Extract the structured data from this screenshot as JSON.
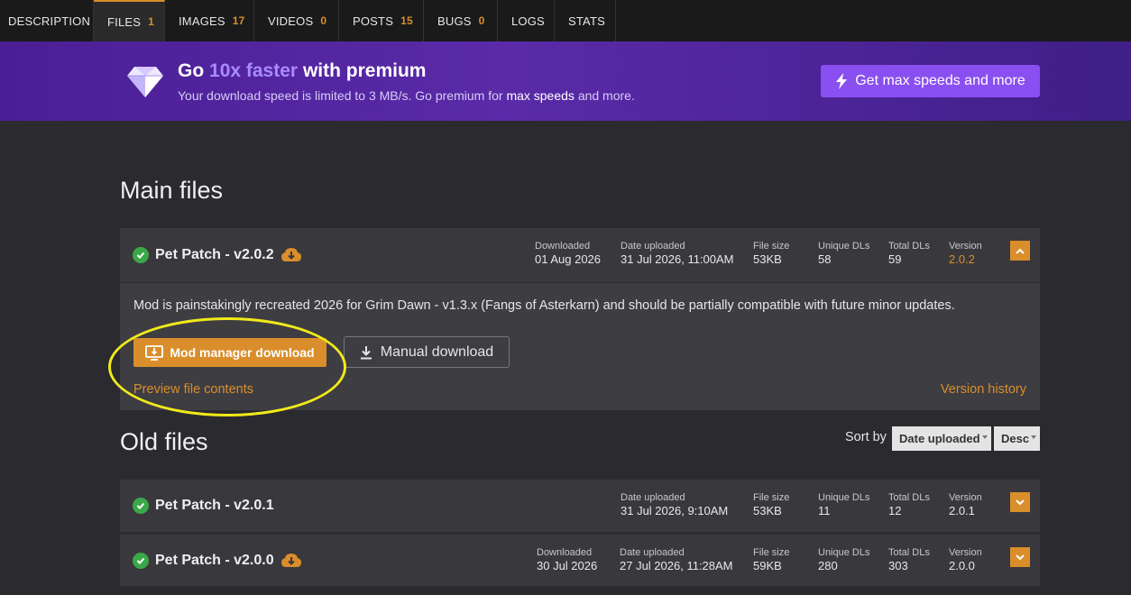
{
  "tabs": [
    {
      "label": "DESCRIPTION",
      "count": ""
    },
    {
      "label": "FILES",
      "count": "1"
    },
    {
      "label": "IMAGES",
      "count": "17"
    },
    {
      "label": "VIDEOS",
      "count": "0"
    },
    {
      "label": "POSTS",
      "count": "15"
    },
    {
      "label": "BUGS",
      "count": "0"
    },
    {
      "label": "LOGS",
      "count": ""
    },
    {
      "label": "STATS",
      "count": ""
    }
  ],
  "active_tab": "FILES",
  "banner": {
    "title_pre": "Go",
    "title_highlight": "10x faster",
    "title_post": "with premium",
    "sub_pre": "Your download speed is limited to 3 MB/s. Go premium for",
    "sub_bold": "max speeds",
    "sub_post": "and more.",
    "button_label": "Get max speeds and more"
  },
  "main_files": {
    "heading": "Main files",
    "file": {
      "name": "Pet Patch - v2.0.2",
      "downloaded_label": "Downloaded",
      "downloaded": "01 Aug 2026",
      "date_uploaded_label": "Date uploaded",
      "date_uploaded": "31 Jul 2026, 11:00AM",
      "file_size_label": "File size",
      "file_size": "53KB",
      "unique_dls_label": "Unique DLs",
      "unique_dls": "58",
      "total_dls_label": "Total DLs",
      "total_dls": "59",
      "version_label": "Version",
      "version": "2.0.2",
      "description": "Mod is painstakingly recreated 2026 for Grim Dawn - v1.3.x (Fangs of Asterkarn) and should be partially compatible with future minor updates.",
      "mod_manager_label": "Mod manager download",
      "manual_label": "Manual download",
      "preview_label": "Preview file contents",
      "history_label": "Version history"
    }
  },
  "old_files": {
    "heading": "Old files",
    "sort_label": "Sort by",
    "sort_field": "Date uploaded",
    "sort_order": "Desc",
    "files": [
      {
        "name": "Pet Patch - v2.0.1",
        "date_uploaded_label": "Date uploaded",
        "date_uploaded": "31 Jul 2026, 9:10AM",
        "file_size_label": "File size",
        "file_size": "53KB",
        "unique_dls_label": "Unique DLs",
        "unique_dls": "11",
        "total_dls_label": "Total DLs",
        "total_dls": "12",
        "version_label": "Version",
        "version": "2.0.1"
      },
      {
        "name": "Pet Patch - v2.0.0",
        "downloaded_label": "Downloaded",
        "downloaded": "30 Jul 2026",
        "date_uploaded_label": "Date uploaded",
        "date_uploaded": "27 Jul 2026, 11:28AM",
        "file_size_label": "File size",
        "file_size": "59KB",
        "unique_dls_label": "Unique DLs",
        "unique_dls": "280",
        "total_dls_label": "Total DLs",
        "total_dls": "303",
        "version_label": "Version",
        "version": "2.0.0"
      }
    ]
  },
  "colors": {
    "accent": "#d98e2b",
    "premium": "#8a4ff0",
    "annotation": "#f0ea1a"
  }
}
